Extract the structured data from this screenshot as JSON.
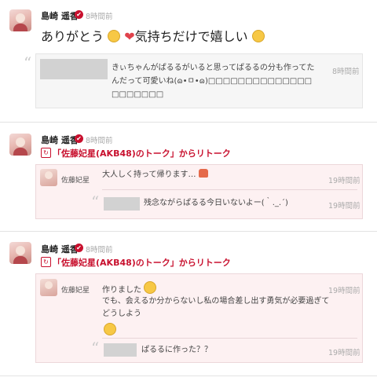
{
  "post1": {
    "name": "島崎 遥香",
    "time": "8時間前",
    "main_text_1": "ありがとう",
    "main_text_2": "気持ちだけで嬉しい",
    "quote": {
      "text_line1": "きぃちゃんがぱるるがいると思ってぱるるの分も作ってた",
      "text_line2": "んだって可愛いね(ɷ•ㅁ•ɷ)□□□□□□□□□□□□□□",
      "text_line3": "□□□□□□□",
      "time": "8時間前"
    }
  },
  "post2": {
    "name": "島崎 遥香",
    "time": "8時間前",
    "retalk_label": "「佐藤妃星(AKB48)のトーク」からリトーク",
    "inner_name": "佐藤妃星",
    "inner_text": "大人しく持って帰ります…",
    "inner_time": "19時間前",
    "reply_text": "残念ながらぱるる今日いないよー(｀._.´)",
    "reply_time": "19時間前"
  },
  "post3": {
    "name": "島崎 遥香",
    "time": "8時間前",
    "retalk_label": "「佐藤妃星(AKB48)のトーク」からリトーク",
    "inner_name": "佐藤妃星",
    "inner_line1": "作りました",
    "inner_line2": "でも、会えるか分からないし私の場合差し出す勇気が必要過ぎて",
    "inner_line3": "どうしよう",
    "inner_time": "19時間前",
    "reply_text": "ぱるるに作った？？",
    "reply_time": "19時間前"
  },
  "icons": {
    "verified": "verified-badge-icon",
    "retalk": "retalk-icon",
    "quote": "quote-mark-icon"
  },
  "colors": {
    "accent": "#c8102e",
    "pink_bg": "#fdf1f2"
  }
}
